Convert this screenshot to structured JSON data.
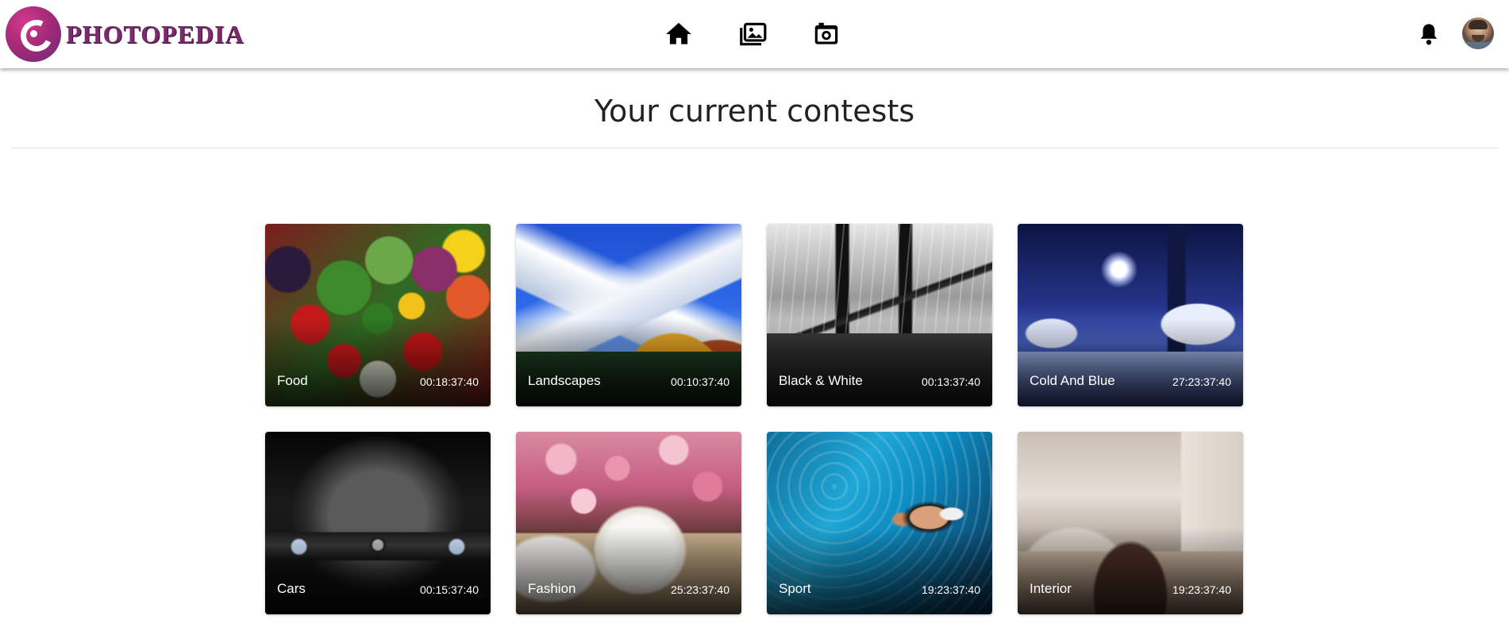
{
  "brand": {
    "name": "PHOTOPEDIA",
    "colors": {
      "primary": "#7a2b6e",
      "logo_gradient_start": "#d23a8a",
      "logo_gradient_end": "#6a2b7c"
    }
  },
  "nav": {
    "items": [
      {
        "icon": "home-icon"
      },
      {
        "icon": "photo-gallery-icon"
      },
      {
        "icon": "camera-icon"
      }
    ]
  },
  "header_right": {
    "notification_icon": "bell-icon",
    "avatar_icon": "user-avatar"
  },
  "page": {
    "title": "Your current contests"
  },
  "contests": [
    {
      "name": "Food",
      "timer": "00:18:37:40"
    },
    {
      "name": "Landscapes",
      "timer": "00:10:37:40"
    },
    {
      "name": "Black & White",
      "timer": "00:13:37:40"
    },
    {
      "name": "Cold And Blue",
      "timer": "27:23:37:40"
    },
    {
      "name": "Cars",
      "timer": "00:15:37:40"
    },
    {
      "name": "Fashion",
      "timer": "25:23:37:40"
    },
    {
      "name": "Sport",
      "timer": "19:23:37:40"
    },
    {
      "name": "Interior",
      "timer": "19:23:37:40"
    }
  ]
}
